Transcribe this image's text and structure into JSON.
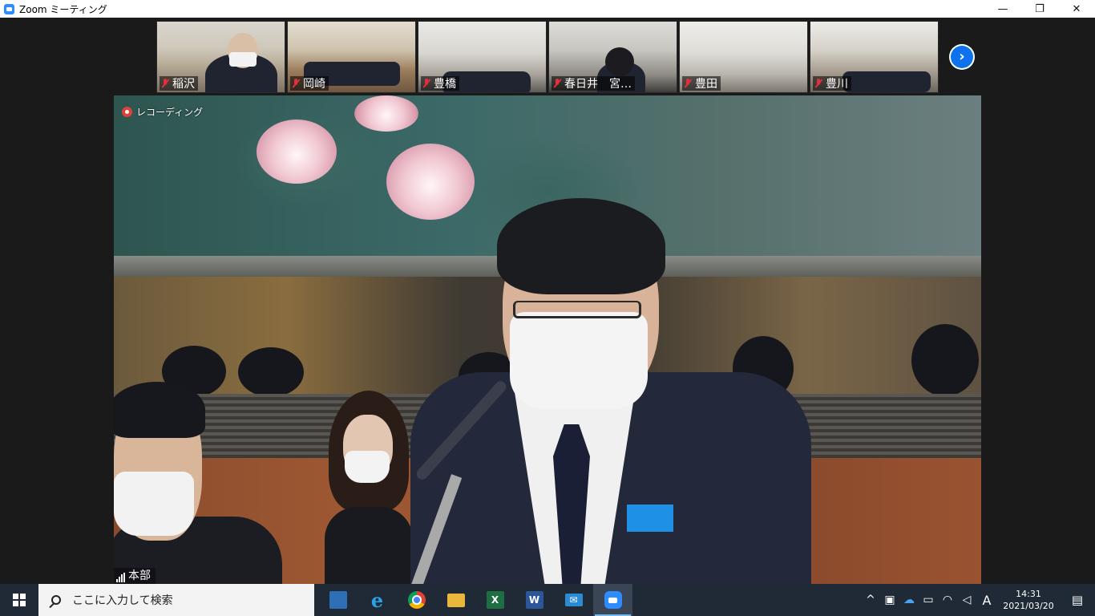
{
  "window": {
    "title": "Zoom ミーティング",
    "controls": {
      "minimize": "—",
      "restore": "❐",
      "close": "✕"
    }
  },
  "thumbnails": [
    {
      "name": "稲沢",
      "muted": true
    },
    {
      "name": "岡崎",
      "muted": true
    },
    {
      "name": "豊橋",
      "muted": true
    },
    {
      "name": "春日井　宮…",
      "muted": true
    },
    {
      "name": "豊田",
      "muted": true
    },
    {
      "name": "豊川",
      "muted": true
    }
  ],
  "next_page_icon": "chevron-right-icon",
  "main": {
    "recording_label": "レコーディング",
    "speaker_name": "本部"
  },
  "taskbar": {
    "search_placeholder": "ここに入力して検索",
    "apps": [
      {
        "name": "news-app",
        "glyph": ""
      },
      {
        "name": "internet-explorer",
        "glyph": "e"
      },
      {
        "name": "chrome",
        "glyph": ""
      },
      {
        "name": "file-explorer",
        "glyph": ""
      },
      {
        "name": "excel",
        "glyph": "X"
      },
      {
        "name": "word",
        "glyph": "W"
      },
      {
        "name": "mail",
        "glyph": "✉"
      },
      {
        "name": "zoom",
        "glyph": ""
      }
    ],
    "tray": {
      "chevron": "^",
      "ime": "A",
      "time": "14:31",
      "date": "2021/03/20"
    }
  },
  "colors": {
    "zoom_blue": "#2d8cff",
    "mute_red": "#e0303a",
    "taskbar": "#1f2a36"
  }
}
